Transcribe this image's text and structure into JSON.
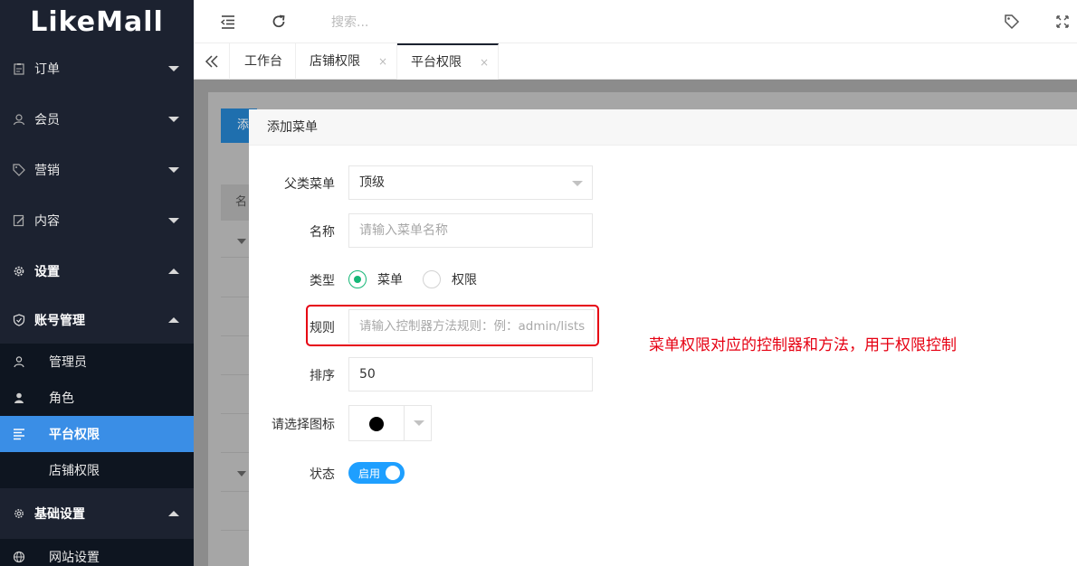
{
  "app": {
    "logo": "LikeMall"
  },
  "sidebar": {
    "items": [
      {
        "label": "订单",
        "icon": "clipboard-icon"
      },
      {
        "label": "会员",
        "icon": "user-icon"
      },
      {
        "label": "营销",
        "icon": "tag-icon"
      },
      {
        "label": "内容",
        "icon": "edit-doc-icon"
      },
      {
        "label": "设置",
        "icon": "gear-icon"
      },
      {
        "label": "账号管理",
        "icon": "shield-icon"
      }
    ],
    "account_sub": [
      {
        "label": "管理员",
        "icon": "person-outline-icon"
      },
      {
        "label": "角色",
        "icon": "person-filled-icon"
      },
      {
        "label": "平台权限",
        "icon": "list-lines-icon"
      },
      {
        "label": "店铺权限"
      }
    ],
    "basic": {
      "label": "基础设置",
      "icon": "gear-small-icon"
    },
    "basic_sub": [
      {
        "label": "网站设置",
        "icon": "globe-icon"
      }
    ]
  },
  "header": {
    "search_placeholder": "搜索..."
  },
  "tabs": [
    {
      "label": "工作台"
    },
    {
      "label": "店铺权限",
      "close": "×"
    },
    {
      "label": "平台权限",
      "close": "×"
    }
  ],
  "background": {
    "add_button": "添",
    "table_header": "名"
  },
  "modal": {
    "title": "添加菜单",
    "fields": {
      "parent": {
        "label": "父类菜单",
        "value": "顶级"
      },
      "name": {
        "label": "名称",
        "placeholder": "请输入菜单名称"
      },
      "type": {
        "label": "类型",
        "options": [
          "菜单",
          "权限"
        ],
        "selected": "菜单"
      },
      "rule": {
        "label": "规则",
        "placeholder": "请输入控制器方法规则：例：admin/lists"
      },
      "sort": {
        "label": "排序",
        "value": "50"
      },
      "icon": {
        "label": "请选择图标"
      },
      "status": {
        "label": "状态",
        "switch_text": "启用"
      }
    }
  },
  "annotation": "菜单权限对应的控制器和方法，用于权限控制",
  "colors": {
    "sidebar": "#1c2230",
    "active": "#3a8ee6",
    "radio": "#16b777",
    "switch": "#1e9fff",
    "annotation": "#e60012"
  }
}
